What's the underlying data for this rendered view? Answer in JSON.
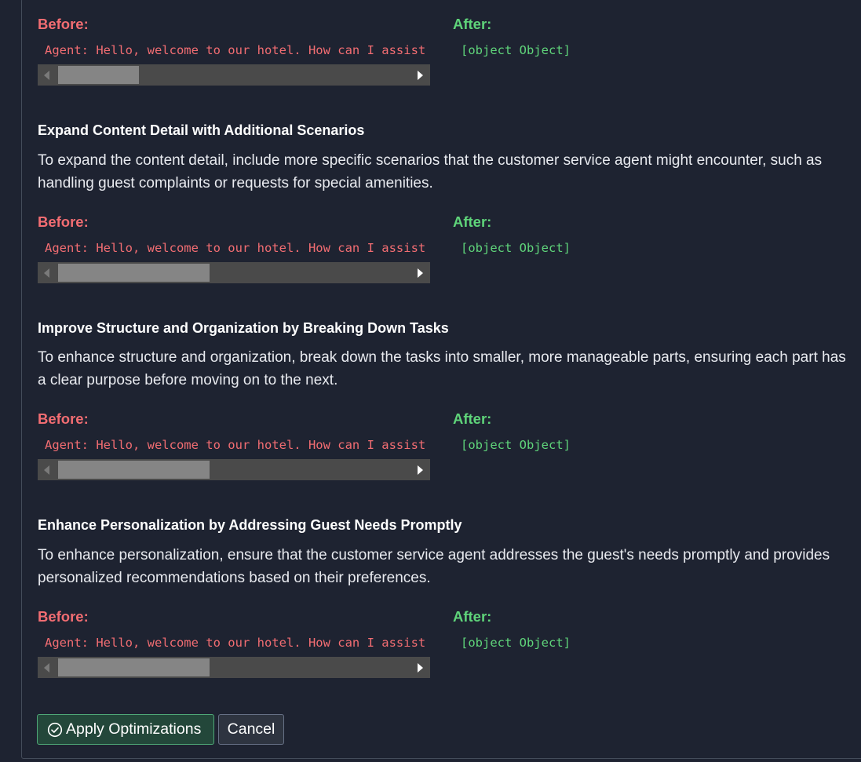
{
  "labels": {
    "before": "Before:",
    "after": "After:"
  },
  "sections": [
    {
      "title": "",
      "description": "",
      "before_code": "Agent: Hello, welcome to our hotel. How can I assist",
      "after_code": "[object Object]",
      "scroll_fraction": 0.23
    },
    {
      "title": "Expand Content Detail with Additional Scenarios",
      "description": "To expand the content detail, include more specific scenarios that the customer service agent might encounter, such as handling guest complaints or requests for special amenities.",
      "before_code": "Agent: Hello, welcome to our hotel. How can I assist",
      "after_code": "[object Object]",
      "scroll_fraction": 0.43
    },
    {
      "title": "Improve Structure and Organization by Breaking Down Tasks",
      "description": "To enhance structure and organization, break down the tasks into smaller, more manageable parts, ensuring each part has a clear purpose before moving on to the next.",
      "before_code": "Agent: Hello, welcome to our hotel. How can I assist",
      "after_code": "[object Object]",
      "scroll_fraction": 0.43
    },
    {
      "title": "Enhance Personalization by Addressing Guest Needs Promptly",
      "description": "To enhance personalization, ensure that the customer service agent addresses the guest's needs promptly and provides personalized recommendations based on their preferences.",
      "before_code": "Agent: Hello, welcome to our hotel. How can I assist",
      "after_code": "[object Object]",
      "scroll_fraction": 0.43
    }
  ],
  "actions": {
    "apply_label": "Apply Optimizations",
    "cancel_label": "Cancel"
  },
  "colors": {
    "background": "#1e2331",
    "before": "#f26d72",
    "after": "#5fd47a",
    "apply_bg": "#23473a",
    "apply_border": "#4fa877"
  },
  "icons": {
    "apply": "check-circle-icon"
  }
}
